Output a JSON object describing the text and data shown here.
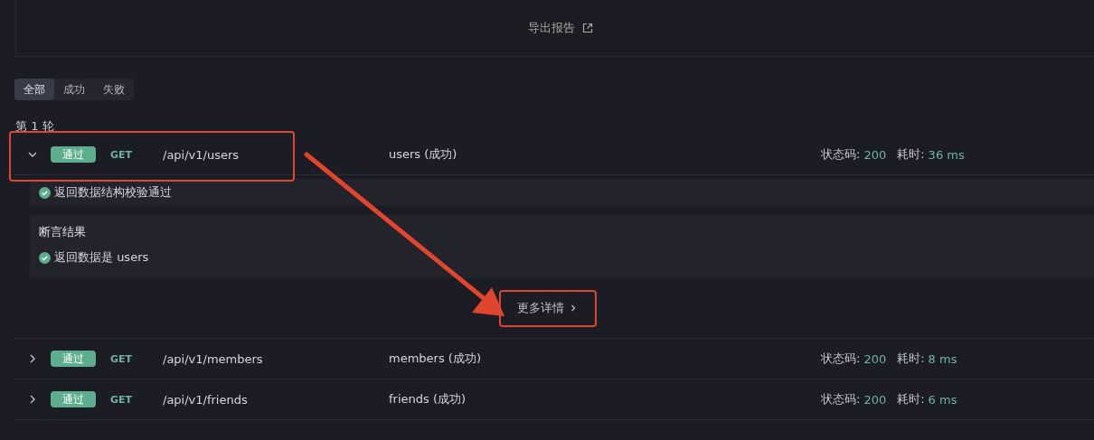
{
  "export_link": {
    "label": "导出报告"
  },
  "filter_tabs": [
    {
      "label": "全部",
      "selected": true
    },
    {
      "label": "成功",
      "selected": false
    },
    {
      "label": "失败",
      "selected": false
    }
  ],
  "round_title": "第 1 轮",
  "requests": [
    {
      "expanded": true,
      "highlighted": true,
      "result": "通过",
      "method": "GET",
      "path": "/api/v1/users",
      "name": "users (成功)",
      "status_label": "状态码:",
      "status_code": "200",
      "time_label": "耗时:",
      "time": "36 ms",
      "details": {
        "schema_check": "返回数据结构校验通过",
        "assertions_title": "断言结果",
        "assertions": [
          "返回数据是 users"
        ],
        "more_button": {
          "label": "更多详情",
          "highlighted": true
        }
      }
    },
    {
      "expanded": false,
      "highlighted": false,
      "result": "通过",
      "method": "GET",
      "path": "/api/v1/members",
      "name": "members (成功)",
      "status_label": "状态码:",
      "status_code": "200",
      "time_label": "耗时:",
      "time": "8 ms"
    },
    {
      "expanded": false,
      "highlighted": false,
      "result": "通过",
      "method": "GET",
      "path": "/api/v1/friends",
      "name": "friends (成功)",
      "status_label": "状态码:",
      "status_code": "200",
      "time_label": "耗时:",
      "time": "6 ms"
    }
  ]
}
